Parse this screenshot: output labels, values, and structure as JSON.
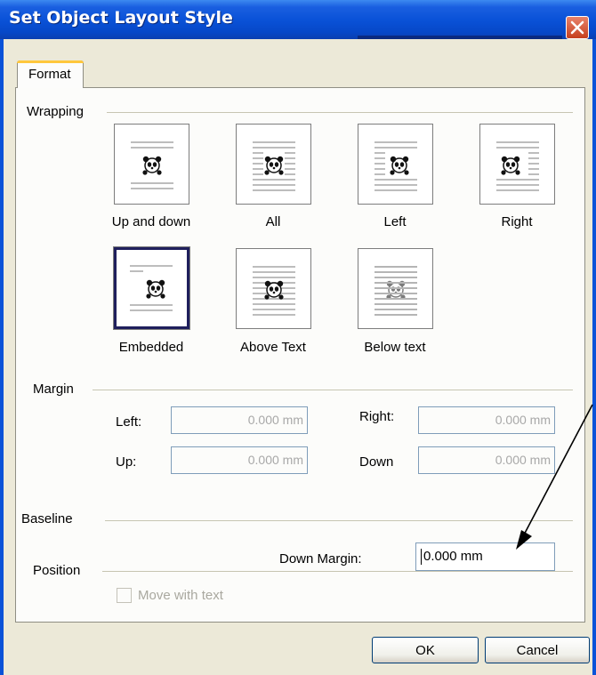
{
  "window": {
    "title": "Set Object Layout Style"
  },
  "tabs": [
    {
      "label": "Format"
    }
  ],
  "wrapping": {
    "heading": "Wrapping",
    "options": [
      {
        "label": "Up and down",
        "selected": false
      },
      {
        "label": "All",
        "selected": false
      },
      {
        "label": "Left",
        "selected": false
      },
      {
        "label": "Right",
        "selected": false
      },
      {
        "label": "Embedded",
        "selected": true
      },
      {
        "label": "Above Text",
        "selected": false
      },
      {
        "label": "Below text",
        "selected": false
      }
    ]
  },
  "margin": {
    "heading": "Margin",
    "left_label": "Left:",
    "left_value": "0.000 mm",
    "right_label": "Right:",
    "right_value": "0.000 mm",
    "up_label": "Up:",
    "up_value": "0.000 mm",
    "down_label": "Down",
    "down_value": "0.000 mm"
  },
  "baseline": {
    "heading": "Baseline",
    "down_margin_label": "Down Margin:",
    "down_margin_value": "0.000 mm"
  },
  "position": {
    "heading": "Position",
    "move_with_text_label": "Move with text",
    "move_with_text_checked": false
  },
  "buttons": {
    "ok": "OK",
    "cancel": "Cancel"
  },
  "colors": {
    "titlebar": "#0a52d8",
    "close": "#c6401e",
    "selected_border": "#1f1f5c"
  },
  "icons": {
    "close": "close-icon",
    "wrap_preview": "panda-image-icon"
  }
}
